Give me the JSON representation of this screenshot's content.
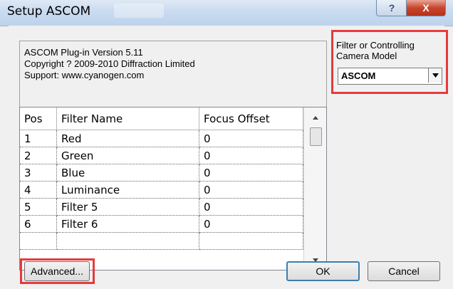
{
  "window": {
    "title": "Setup ASCOM",
    "help_label": "?",
    "close_label": "X"
  },
  "info": {
    "version": "ASCOM Plug-in Version 5.11",
    "copyright": "Copyright ? 2009-2010 Diffraction Limited",
    "support": "Support: www.cyanogen.com"
  },
  "filter_model": {
    "label_line1": "Filter or Controlling",
    "label_line2": "Camera Model",
    "selected": "ASCOM"
  },
  "grid": {
    "headers": [
      "Pos",
      "Filter Name",
      "Focus Offset"
    ],
    "rows": [
      {
        "pos": "1",
        "name": "Red",
        "offset": "0"
      },
      {
        "pos": "2",
        "name": "Green",
        "offset": "0"
      },
      {
        "pos": "3",
        "name": "Blue",
        "offset": "0"
      },
      {
        "pos": "4",
        "name": "Luminance",
        "offset": "0"
      },
      {
        "pos": "5",
        "name": "Filter 5",
        "offset": "0"
      },
      {
        "pos": "6",
        "name": "Filter 6",
        "offset": "0"
      }
    ]
  },
  "buttons": {
    "advanced": "Advanced...",
    "ok": "OK",
    "cancel": "Cancel"
  },
  "colors": {
    "highlight": "#e53b3b",
    "default_button_border": "#3c7fb1"
  },
  "icons": {
    "help": "help-icon",
    "close": "close-icon",
    "dropdown": "chevron-down-icon",
    "scroll_up": "scroll-up-icon",
    "scroll_down": "scroll-down-icon"
  }
}
